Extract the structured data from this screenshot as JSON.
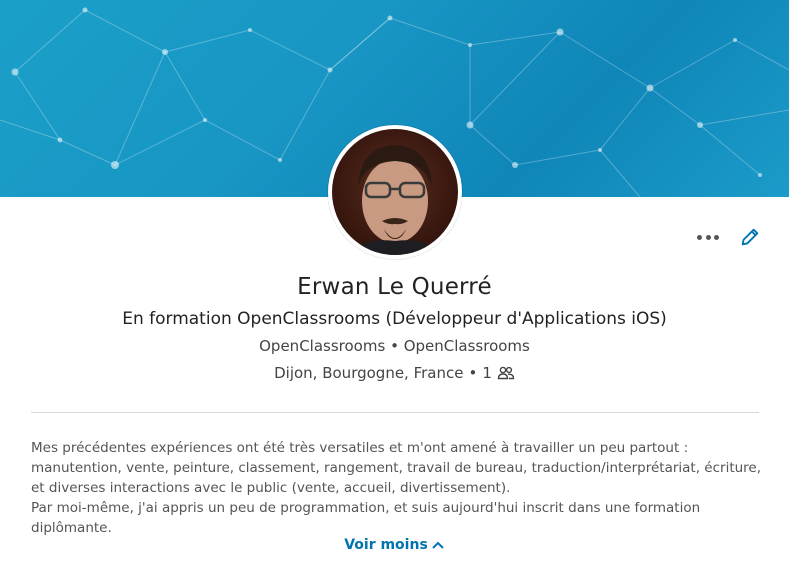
{
  "profile": {
    "name": "Erwan Le Querré",
    "headline": "En formation OpenClassrooms (Développeur d'Applications iOS)",
    "company_current": "OpenClassrooms",
    "company_education": "OpenClassrooms",
    "separator": "•",
    "location": "Dijon, Bourgogne, France",
    "connections": "1",
    "avatar_icon": "profile-photo"
  },
  "actions": {
    "more_icon": "ellipsis-icon",
    "edit_icon": "pencil-icon"
  },
  "summary": {
    "paragraph1": "Mes précédentes expériences ont été très versatiles et m'ont amené à travailler un peu partout : manutention, vente, peinture, classement, rangement, travail de bureau, traduction/interprétariat, écriture, et diverses interactions avec le public (vente, accueil, divertissement).",
    "paragraph2": "Par moi-même, j'ai appris un peu de programmation, et suis aujourd'hui inscrit dans une formation diplômante.",
    "see_less_label": "Voir moins"
  },
  "colors": {
    "banner": "#1896c4",
    "link": "#0073b1",
    "text": "#333333"
  }
}
